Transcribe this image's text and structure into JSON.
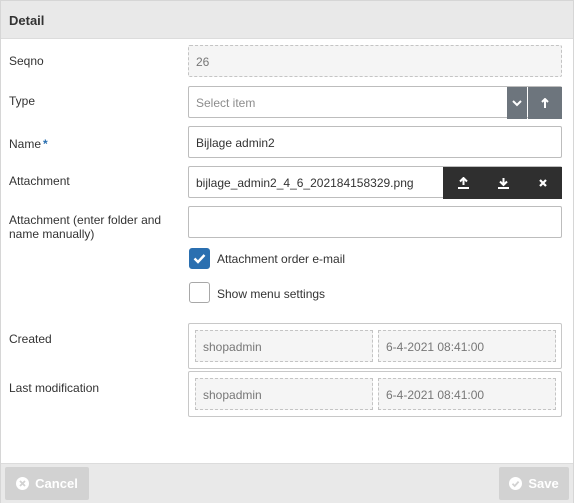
{
  "panel": {
    "title": "Detail"
  },
  "fields": {
    "seqno": {
      "label": "Seqno",
      "value": "26"
    },
    "type": {
      "label": "Type",
      "placeholder": "Select item"
    },
    "name": {
      "label": "Name",
      "required_mark": "*",
      "value": "Bijlage admin2"
    },
    "attachment": {
      "label": "Attachment",
      "value": "bijlage_admin2_4_6_202184158329.png"
    },
    "attachment_manual": {
      "label": "Attachment (enter folder and name manually)",
      "value": ""
    }
  },
  "checkboxes": [
    {
      "label": "Attachment order e-mail",
      "checked": true
    },
    {
      "label": "Show menu settings",
      "checked": false
    }
  ],
  "created": {
    "label": "Created",
    "user": "shopadmin",
    "date": "6-4-2021 08:41:00"
  },
  "modified": {
    "label": "Last modification",
    "user": "shopadmin",
    "date": "6-4-2021 08:41:00"
  },
  "footer": {
    "cancel_label": "Cancel",
    "save_label": "Save"
  },
  "icons": {
    "dropdown": "chevron-down-icon",
    "type_action": "upload-icon",
    "upload": "upload-icon",
    "download": "download-icon",
    "clear": "close-icon",
    "checkbox": "checkmark-icon",
    "cancel": "cancel-icon",
    "save": "check-circle-icon"
  },
  "colors": {
    "accent": "#2a6fb0",
    "dark_button": "#2f2f2f",
    "grey_button": "#6d757d",
    "footer_button": "#d2d2d2"
  }
}
